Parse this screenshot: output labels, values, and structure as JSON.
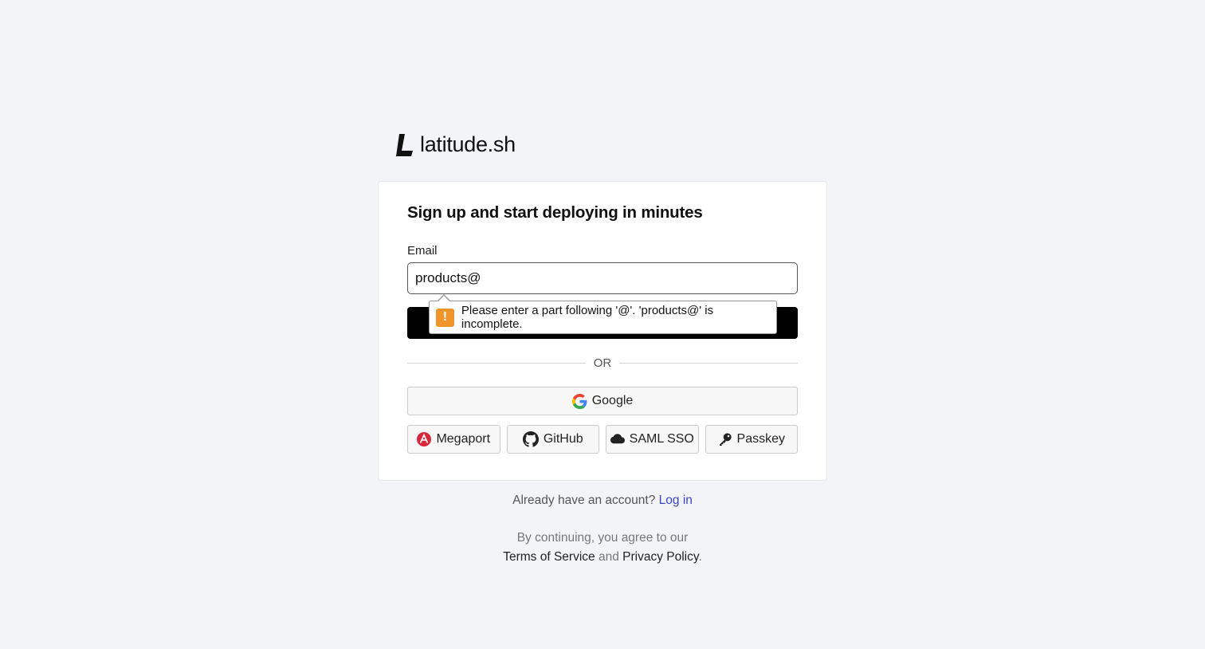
{
  "brand": {
    "name": "latitude.sh"
  },
  "signup": {
    "title": "Sign up and start deploying in minutes",
    "email_label": "Email",
    "email_value": "products@",
    "submit_label": "",
    "validation_message": "Please enter a part following '@'. 'products@' is incomplete.",
    "divider_text": "OR"
  },
  "providers": {
    "google": "Google",
    "megaport": "Megaport",
    "github": "GitHub",
    "saml": "SAML SSO",
    "passkey": "Passkey"
  },
  "footer": {
    "already_text": "Already have an account?",
    "login_link": "Log in",
    "terms_intro": "By continuing, you agree to our",
    "terms_link": "Terms of Service",
    "and_text": "and",
    "privacy_link": "Privacy Policy",
    "period": "."
  },
  "colors": {
    "background": "#f3f4f7",
    "link": "#3c44c8",
    "warning": "#f0952b",
    "primary_button": "#000000",
    "megaport_brand": "#d6283a"
  }
}
